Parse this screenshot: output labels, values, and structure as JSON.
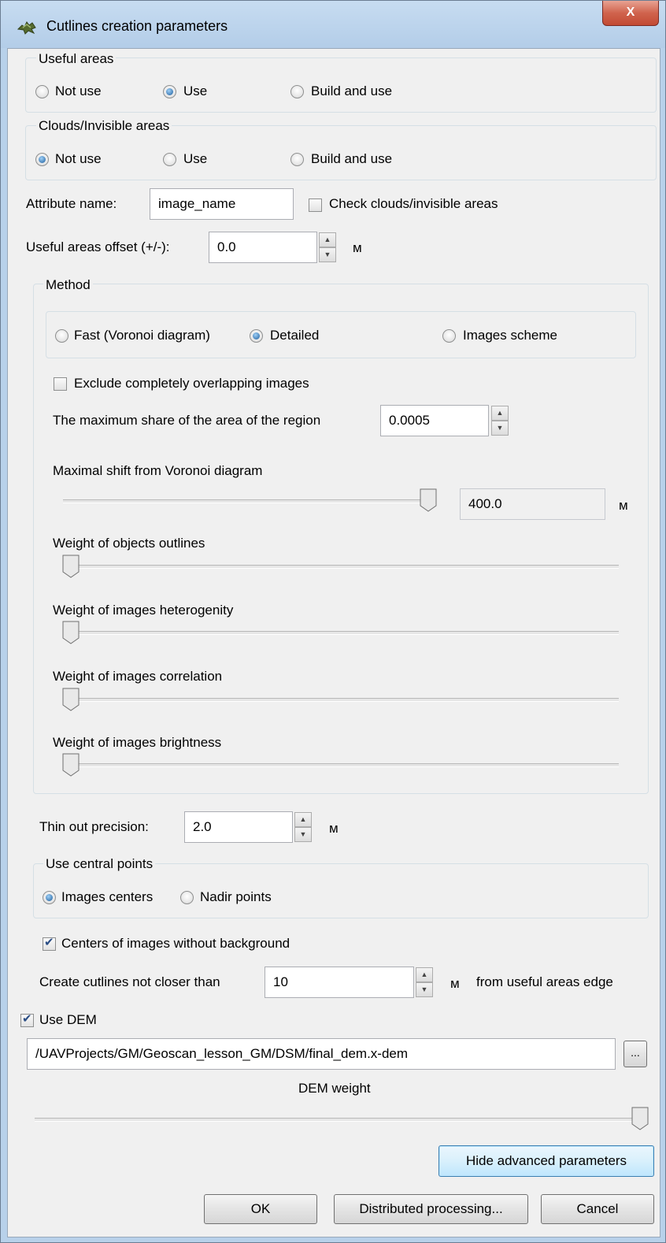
{
  "window": {
    "title": "Cutlines creation parameters",
    "close_glyph": "X"
  },
  "useful_areas": {
    "label": "Useful areas",
    "options": [
      "Not use",
      "Use",
      "Build and use"
    ],
    "selected": "Use"
  },
  "clouds_areas": {
    "label": "Clouds/Invisible areas",
    "options": [
      "Not use",
      "Use",
      "Build and use"
    ],
    "selected": "Not use"
  },
  "attribute": {
    "label": "Attribute name:",
    "value": "image_name",
    "check_label": "Check clouds/invisible areas",
    "checked": false
  },
  "offset": {
    "label": "Useful areas offset (+/-):",
    "value": "0.0",
    "unit": "м"
  },
  "method": {
    "label": "Method",
    "options": [
      "Fast (Voronoi diagram)",
      "Detailed",
      "Images scheme"
    ],
    "selected": "Detailed",
    "exclude_label": "Exclude completely overlapping images",
    "exclude_checked": false,
    "max_share_label": "The maximum share of the area of the region",
    "max_share_value": "0.0005",
    "max_shift_label": "Maximal shift from Voronoi diagram",
    "max_shift_value": "400.0",
    "max_shift_unit": "м",
    "max_shift_slider": 1.0,
    "weights": [
      {
        "label": "Weight of objects outlines",
        "level": 0
      },
      {
        "label": "Weight of images heterogenity",
        "level": 0
      },
      {
        "label": "Weight of images correlation",
        "level": 0
      },
      {
        "label": "Weight of images brightness",
        "level": 0
      }
    ]
  },
  "thin_out": {
    "label": "Thin out precision:",
    "value": "2.0",
    "unit": "м"
  },
  "central_points": {
    "label": "Use central points",
    "options": [
      "Images centers",
      "Nadir points"
    ],
    "selected": "Images centers"
  },
  "centers_bg": {
    "label": "Centers of images without background",
    "checked": true
  },
  "cutlines_dist": {
    "label": "Create cutlines not closer than",
    "value": "10",
    "unit": "м",
    "suffix": "from useful areas edge"
  },
  "dem": {
    "label": "Use DEM",
    "checked": true,
    "path": "/UAVProjects/GM/Geoscan_lesson_GM/DSM/final_dem.x-dem",
    "browse_label": "...",
    "weight_label": "DEM weight",
    "weight_level": 1.0
  },
  "buttons": {
    "advanced": "Hide advanced parameters",
    "ok": "OK",
    "distributed": "Distributed processing...",
    "cancel": "Cancel"
  },
  "colors": {
    "selection": "#1d5d9c",
    "titlebar": "#b8d1ea",
    "close": "#c24a33",
    "default_button": "#3c7fb1"
  }
}
